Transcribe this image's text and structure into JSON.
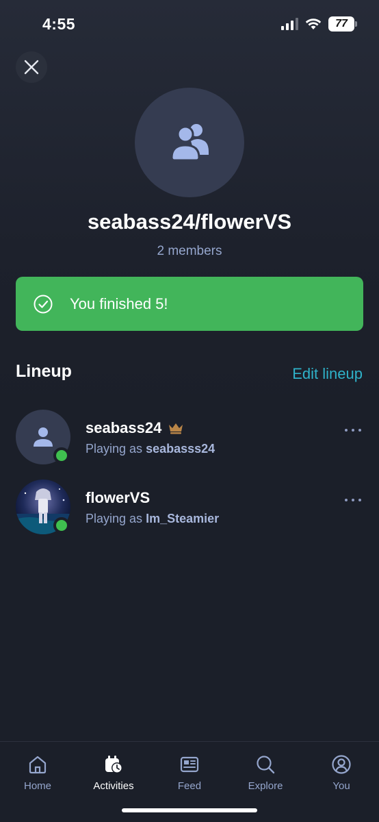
{
  "status": {
    "time": "4:55",
    "battery": "77"
  },
  "header": {
    "close_icon": "close-icon"
  },
  "group": {
    "title": "seabass24/flowerVS",
    "members": "2 members",
    "avatar_icon": "group-users-icon"
  },
  "banner": {
    "text": "You finished 5!",
    "icon": "check-circle-icon",
    "color": "#42b55a"
  },
  "lineup": {
    "title": "Lineup",
    "edit_label": "Edit lineup",
    "members": [
      {
        "name": "seabass24",
        "playing_prefix": "Playing as",
        "playing_as": "seabasss24",
        "crown": true,
        "online": true
      },
      {
        "name": "flowerVS",
        "playing_prefix": "Playing as",
        "playing_as": "Im_Steamier",
        "crown": false,
        "online": true
      }
    ]
  },
  "tabbar": {
    "items": [
      {
        "label": "Home",
        "icon": "home-icon",
        "active": false
      },
      {
        "label": "Activities",
        "icon": "activities-icon",
        "active": true
      },
      {
        "label": "Feed",
        "icon": "feed-icon",
        "active": false
      },
      {
        "label": "Explore",
        "icon": "search-icon",
        "active": false
      },
      {
        "label": "You",
        "icon": "profile-icon",
        "active": false
      }
    ]
  },
  "colors": {
    "background": "#1b1f29",
    "accent": "#2fb2c9",
    "online": "#3fbf4f",
    "crown": "#b98547"
  }
}
